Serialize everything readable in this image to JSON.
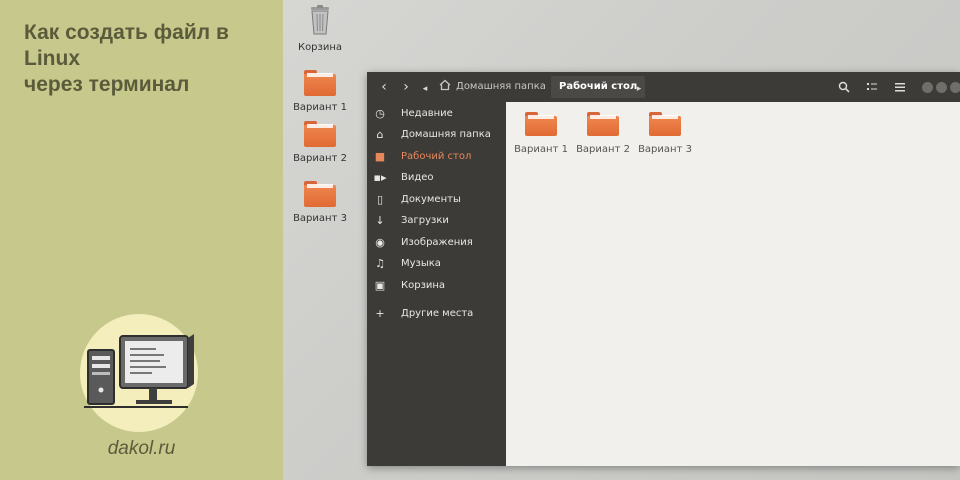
{
  "banner": {
    "title_line1": "Как создать файл в Linux",
    "title_line2": "через терминал",
    "site": "dakol.ru",
    "bg_color": "#c7c98c"
  },
  "desktop": {
    "icons": [
      {
        "label": "Корзина",
        "icon": "trash-icon"
      },
      {
        "label": "Вариант 1",
        "icon": "folder-icon"
      },
      {
        "label": "Вариант 2",
        "icon": "folder-icon"
      },
      {
        "label": "Вариант 3",
        "icon": "folder-icon"
      }
    ]
  },
  "file_manager": {
    "breadcrumbs": {
      "home": "Домашняя папка",
      "current": "Рабочий стол"
    },
    "sidebar": [
      {
        "label": "Недавние",
        "icon": "clock-icon"
      },
      {
        "label": "Домашняя папка",
        "icon": "home-icon"
      },
      {
        "label": "Рабочий стол",
        "icon": "folder-icon",
        "active": true
      },
      {
        "label": "Видео",
        "icon": "video-icon"
      },
      {
        "label": "Документы",
        "icon": "document-icon"
      },
      {
        "label": "Загрузки",
        "icon": "download-icon"
      },
      {
        "label": "Изображения",
        "icon": "camera-icon"
      },
      {
        "label": "Музыка",
        "icon": "music-icon"
      },
      {
        "label": "Корзина",
        "icon": "trash-icon"
      },
      {
        "label": "Другие места",
        "icon": "plus-icon"
      }
    ],
    "folders": [
      {
        "label": "Вариант 1"
      },
      {
        "label": "Вариант 2"
      },
      {
        "label": "Вариант 3"
      }
    ],
    "accent_color": "#e8875a",
    "sidebar_color": "#3c3b37"
  }
}
